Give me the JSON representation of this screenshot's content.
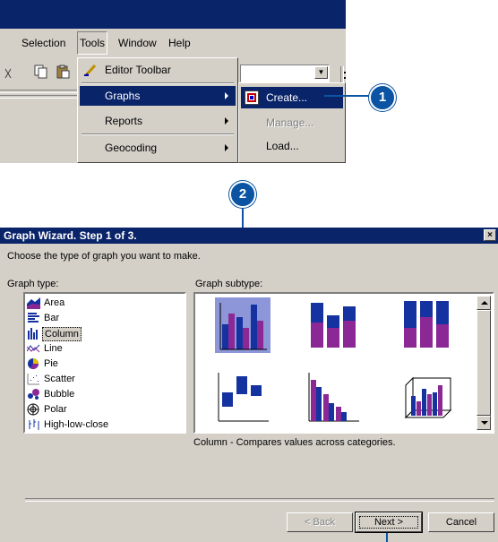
{
  "menubar": {
    "items": [
      {
        "label": "Selection"
      },
      {
        "label": "Tools"
      },
      {
        "label": "Window"
      },
      {
        "label": "Help"
      }
    ]
  },
  "tools_menu": {
    "items": [
      {
        "label": "Editor Toolbar"
      },
      {
        "label": "Graphs"
      },
      {
        "label": "Reports"
      },
      {
        "label": "Geocoding"
      }
    ]
  },
  "graphs_submenu": {
    "items": [
      {
        "label": "Create..."
      },
      {
        "label": "Manage..."
      },
      {
        "label": "Load..."
      }
    ]
  },
  "callouts": [
    "1",
    "2"
  ],
  "dialog": {
    "title": "Graph Wizard. Step 1 of 3.",
    "close_label": "×",
    "prompt": "Choose the type of graph you want to make.",
    "graph_type_label": "Graph type:",
    "graph_subtype_label": "Graph subtype:",
    "graph_types": [
      {
        "label": "Area",
        "icon": "area-chart-icon"
      },
      {
        "label": "Bar",
        "icon": "bar-chart-icon"
      },
      {
        "label": "Column",
        "icon": "column-chart-icon"
      },
      {
        "label": "Line",
        "icon": "line-chart-icon"
      },
      {
        "label": "Pie",
        "icon": "pie-chart-icon"
      },
      {
        "label": "Scatter",
        "icon": "scatter-chart-icon"
      },
      {
        "label": "Bubble",
        "icon": "bubble-chart-icon"
      },
      {
        "label": "Polar",
        "icon": "polar-chart-icon"
      },
      {
        "label": "High-low-close",
        "icon": "high-low-close-chart-icon"
      }
    ],
    "selected_type": "Column",
    "description": "Column - Compares values across categories.",
    "buttons": {
      "back": "< Back",
      "next": "Next >",
      "cancel": "Cancel"
    }
  },
  "colors": {
    "title_bar": "#0a246a",
    "chrome": "#d4d0c8",
    "callout": "#0a54a3",
    "column_blue": "#1432a0",
    "column_purple": "#8c2896"
  }
}
